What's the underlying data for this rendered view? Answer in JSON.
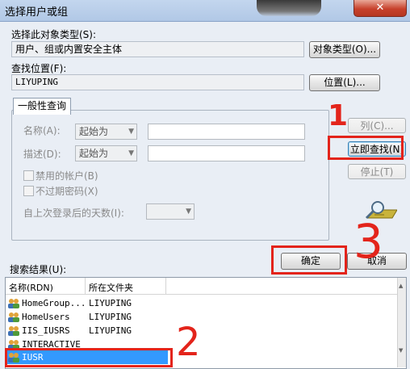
{
  "window": {
    "title": "选择用户或组",
    "close_label": "✕"
  },
  "object_type": {
    "label": "选择此对象类型(S):",
    "value": "用户、组或内置安全主体",
    "button": "对象类型(O)..."
  },
  "location": {
    "label": "查找位置(F):",
    "value": "LIYUPING",
    "button": "位置(L)..."
  },
  "query_tab": {
    "label": "一般性查询"
  },
  "query": {
    "name_label": "名称(A):",
    "name_mode": "起始为",
    "desc_label": "描述(D):",
    "desc_mode": "起始为",
    "disabled_accounts": "禁用的帐户(B)",
    "non_expiring_pw": "不过期密码(X)",
    "days_label": "自上次登录后的天数(I):"
  },
  "side_buttons": {
    "columns": "列(C)...",
    "find_now": "立即查找(N)",
    "stop": "停止(T)"
  },
  "dialog_buttons": {
    "ok": "确定",
    "cancel": "取消"
  },
  "results": {
    "label": "搜索结果(U):",
    "columns": [
      "名称(RDN)",
      "所在文件夹"
    ],
    "rows": [
      {
        "name": "HomeGroup...",
        "folder": "LIYUPING",
        "icon": "group-icon"
      },
      {
        "name": "HomeUsers",
        "folder": "LIYUPING",
        "icon": "group-icon"
      },
      {
        "name": "IIS_IUSRS",
        "folder": "LIYUPING",
        "icon": "group-icon"
      },
      {
        "name": "INTERACTIVE",
        "folder": "",
        "icon": "group-icon"
      },
      {
        "name": "IUSR",
        "folder": "",
        "icon": "group-icon",
        "selected": true
      }
    ]
  },
  "annotations": {
    "step1": "1",
    "step2": "2",
    "step3": "3"
  }
}
